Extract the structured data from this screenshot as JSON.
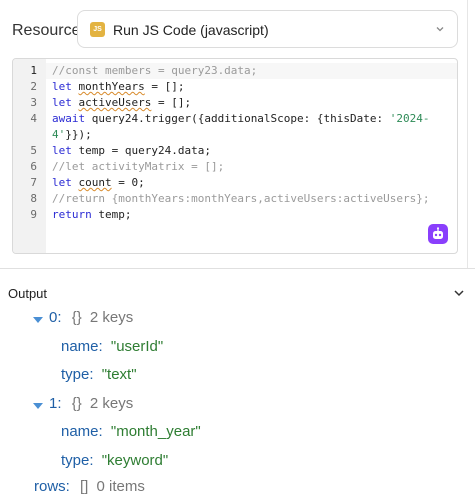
{
  "resource": {
    "label": "Resource",
    "badge": "JS",
    "value": "Run JS Code (javascript)"
  },
  "editor": {
    "line_numbers": [
      "1",
      "2",
      "3",
      "4",
      "",
      "5",
      "6",
      "7",
      "8",
      "9"
    ],
    "lines": [
      "//const members = query23.data;",
      "let monthYears = [];",
      "let activeUsers = [];",
      "await query24.trigger({additionalScope: {thisDate: '2024-",
      "4'}});",
      "let temp = query24.data;",
      "//let activityMatrix = [];",
      "let count = 0;",
      "//return {monthYears:monthYears,activeUsers:activeUsers};",
      "return temp;"
    ]
  },
  "output": {
    "title": "Output",
    "items": [
      {
        "index": "0:",
        "type_icon": "{}",
        "count": "2 keys",
        "fields": [
          {
            "key": "name:",
            "value": "\"userId\""
          },
          {
            "key": "type:",
            "value": "\"text\""
          }
        ]
      },
      {
        "index": "1:",
        "type_icon": "{}",
        "count": "2 keys",
        "fields": [
          {
            "key": "name:",
            "value": "\"month_year\""
          },
          {
            "key": "type:",
            "value": "\"keyword\""
          }
        ]
      }
    ],
    "rows": {
      "key": "rows:",
      "type_icon": "[]",
      "count": "0 items"
    }
  },
  "colors": {
    "accent": "#8a3ffc",
    "js_badge": "#e3b341",
    "key": "#1f5fa6",
    "string": "#2e7d32"
  }
}
